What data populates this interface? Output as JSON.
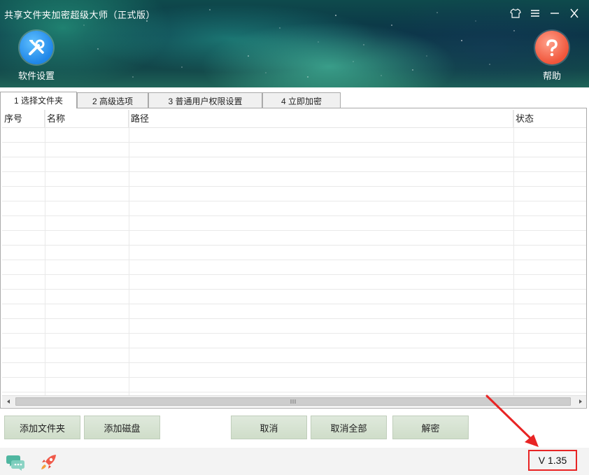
{
  "window": {
    "title": "共享文件夹加密超级大师（正式版）",
    "controls": [
      "skin-icon",
      "menu-icon",
      "minimize-icon",
      "close-icon"
    ]
  },
  "toolbar": {
    "settings_label": "软件设置",
    "help_label": "帮助",
    "settings_icon": "tools-icon",
    "help_icon": "question-icon"
  },
  "tabs": [
    {
      "label": "1 选择文件夹",
      "active": true
    },
    {
      "label": "2 高级选项",
      "active": false
    },
    {
      "label": "3 普通用户权限设置",
      "active": false
    },
    {
      "label": "4 立即加密",
      "active": false
    }
  ],
  "table": {
    "columns": [
      "序号",
      "名称",
      "路径",
      "状态"
    ],
    "rows": []
  },
  "buttons": {
    "add_folder": "添加文件夹",
    "add_disk": "添加磁盘",
    "cancel": "取消",
    "cancel_all": "取消全部",
    "decrypt": "解密"
  },
  "footer": {
    "version": "V 1.35",
    "chat_icon": "chat-icon",
    "rocket_icon": "rocket-icon"
  },
  "colors": {
    "button_bg": "#d6e3d2",
    "version_border": "#e82424",
    "settings_circle": "#2a8ef0",
    "help_circle": "#f25c40"
  }
}
